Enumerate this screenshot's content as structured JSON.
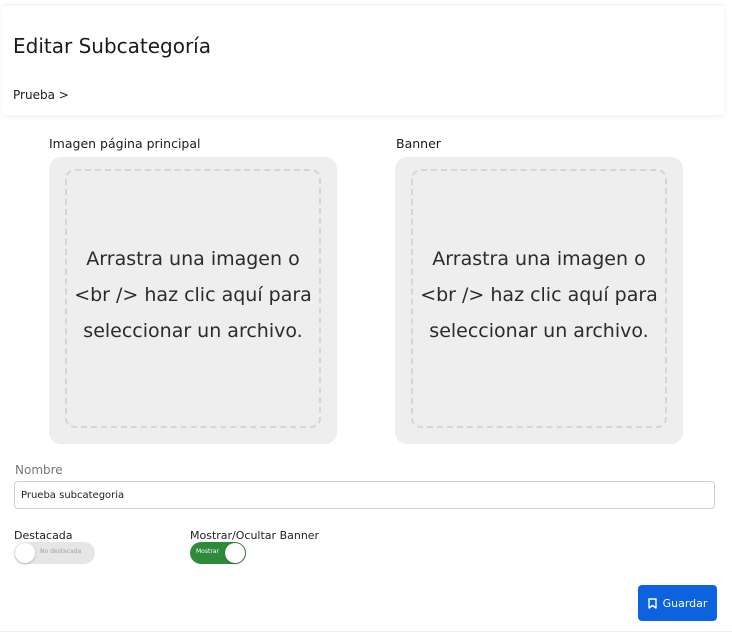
{
  "header": {
    "title": "Editar Subcategoría",
    "breadcrumb": "Prueba >"
  },
  "images": {
    "main_label": "Imagen página principal",
    "banner_label": "Banner",
    "dropzone_text": "Arrastra una imagen o <br /> haz clic aquí para seleccionar un archivo."
  },
  "form": {
    "name_label": "Nombre",
    "name_value": "Prueba subcategoria",
    "featured_label": "Destacada",
    "featured_state_text": "No destacada",
    "featured_on": false,
    "banner_toggle_label": "Mostrar/Ocultar Banner",
    "banner_state_text": "Mostrar",
    "banner_on": true
  },
  "actions": {
    "save_label": "Guardar",
    "save_icon": "bookmark-icon"
  },
  "colors": {
    "primary": "#0d62e0",
    "toggle_on": "#2f8a3a",
    "toggle_off": "#e6e6e6",
    "dropzone_bg": "#eeeeee"
  }
}
